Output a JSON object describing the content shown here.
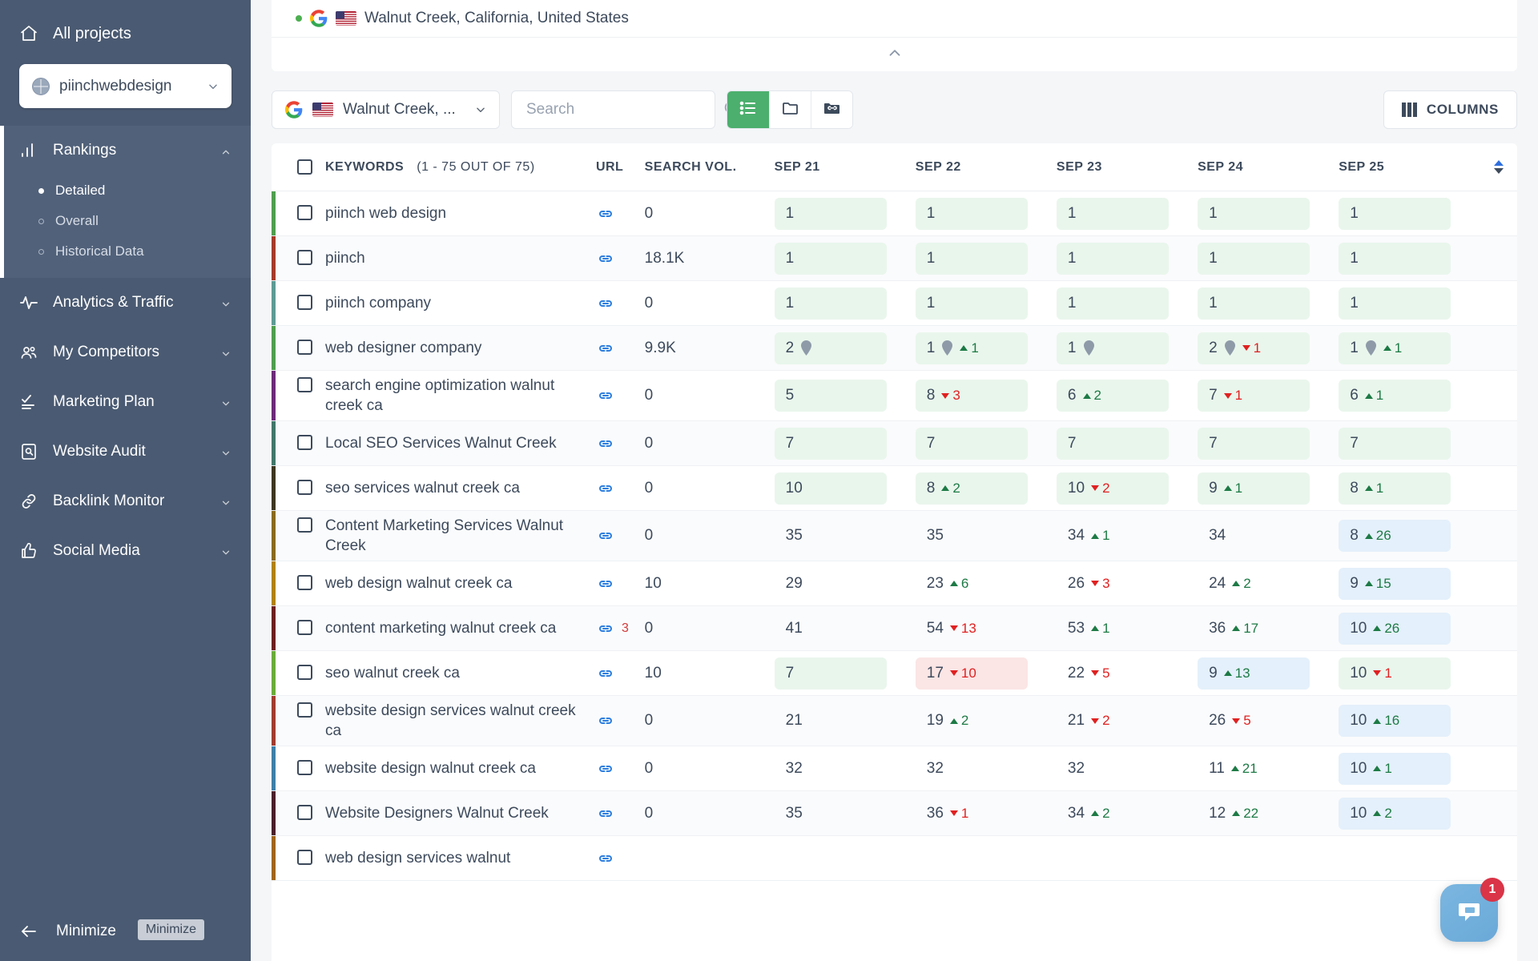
{
  "sidebar": {
    "all_projects_label": "All projects",
    "project_name": "piinchwebdesign",
    "minimize_label": "Minimize",
    "minimize_tooltip": "Minimize",
    "groups": [
      {
        "label": "Rankings",
        "icon": "bar-chart-icon",
        "expanded": true,
        "items": [
          {
            "label": "Detailed",
            "selected": true
          },
          {
            "label": "Overall",
            "selected": false
          },
          {
            "label": "Historical Data",
            "selected": false
          }
        ]
      },
      {
        "label": "Analytics & Traffic",
        "icon": "activity-icon",
        "expanded": false,
        "items": []
      },
      {
        "label": "My Competitors",
        "icon": "people-icon",
        "expanded": false,
        "items": []
      },
      {
        "label": "Marketing Plan",
        "icon": "checklist-icon",
        "expanded": false,
        "items": []
      },
      {
        "label": "Website Audit",
        "icon": "audit-icon",
        "expanded": false,
        "items": []
      },
      {
        "label": "Backlink Monitor",
        "icon": "link-icon",
        "expanded": false,
        "items": []
      },
      {
        "label": "Social Media",
        "icon": "thumbs-up-icon",
        "expanded": false,
        "items": []
      }
    ]
  },
  "header": {
    "location_full": "Walnut Creek, California, United States",
    "engine_icon": "google-icon",
    "flag_icon": "us-flag-icon",
    "status_dot_color": "#4caf50"
  },
  "toolbar": {
    "location_short": "Walnut Creek, ...",
    "search_placeholder": "Search",
    "search_value": "",
    "columns_label": "COLUMNS",
    "views": [
      {
        "name": "list-view",
        "icon": "list-icon",
        "active": true
      },
      {
        "name": "folder-view",
        "icon": "folder-icon",
        "active": false
      },
      {
        "name": "linked-folder-view",
        "icon": "folder-link-icon",
        "active": false
      }
    ]
  },
  "table": {
    "headers": {
      "keywords": "KEYWORDS",
      "keywords_count": "(1 - 75 OUT OF 75)",
      "url": "URL",
      "search_vol": "SEARCH VOL.",
      "days": [
        "SEP 21",
        "SEP 22",
        "SEP 23",
        "SEP 24",
        "SEP 25"
      ]
    },
    "rows": [
      {
        "keyword": "piinch web design",
        "bar": "#4f9e4f",
        "vol": "0",
        "url_badge": "",
        "cells": [
          {
            "rank": "1",
            "delta": "",
            "dir": "",
            "bg": "green",
            "pin": false
          },
          {
            "rank": "1",
            "delta": "",
            "dir": "",
            "bg": "green",
            "pin": false
          },
          {
            "rank": "1",
            "delta": "",
            "dir": "",
            "bg": "green",
            "pin": false
          },
          {
            "rank": "1",
            "delta": "",
            "dir": "",
            "bg": "green",
            "pin": false
          },
          {
            "rank": "1",
            "delta": "",
            "dir": "",
            "bg": "green",
            "pin": false
          }
        ]
      },
      {
        "keyword": "piinch",
        "bar": "#a53a2a",
        "vol": "18.1K",
        "url_badge": "",
        "cells": [
          {
            "rank": "1",
            "delta": "",
            "dir": "",
            "bg": "green",
            "pin": false
          },
          {
            "rank": "1",
            "delta": "",
            "dir": "",
            "bg": "green",
            "pin": false
          },
          {
            "rank": "1",
            "delta": "",
            "dir": "",
            "bg": "green",
            "pin": false
          },
          {
            "rank": "1",
            "delta": "",
            "dir": "",
            "bg": "green",
            "pin": false
          },
          {
            "rank": "1",
            "delta": "",
            "dir": "",
            "bg": "green",
            "pin": false
          }
        ]
      },
      {
        "keyword": "piinch company",
        "bar": "#5e9a95",
        "vol": "0",
        "url_badge": "",
        "cells": [
          {
            "rank": "1",
            "delta": "",
            "dir": "",
            "bg": "green",
            "pin": false
          },
          {
            "rank": "1",
            "delta": "",
            "dir": "",
            "bg": "green",
            "pin": false
          },
          {
            "rank": "1",
            "delta": "",
            "dir": "",
            "bg": "green",
            "pin": false
          },
          {
            "rank": "1",
            "delta": "",
            "dir": "",
            "bg": "green",
            "pin": false
          },
          {
            "rank": "1",
            "delta": "",
            "dir": "",
            "bg": "green",
            "pin": false
          }
        ]
      },
      {
        "keyword": "web designer company",
        "bar": "#4f9e4f",
        "vol": "9.9K",
        "url_badge": "",
        "cells": [
          {
            "rank": "2",
            "delta": "",
            "dir": "",
            "bg": "green",
            "pin": true
          },
          {
            "rank": "1",
            "delta": "1",
            "dir": "up",
            "bg": "green",
            "pin": true
          },
          {
            "rank": "1",
            "delta": "",
            "dir": "",
            "bg": "green",
            "pin": true
          },
          {
            "rank": "2",
            "delta": "1",
            "dir": "down",
            "bg": "green",
            "pin": true
          },
          {
            "rank": "1",
            "delta": "1",
            "dir": "up",
            "bg": "green",
            "pin": true
          }
        ]
      },
      {
        "keyword": "search engine optimization walnut creek ca",
        "bar": "#6b2a78",
        "vol": "0",
        "url_badge": "",
        "cells": [
          {
            "rank": "5",
            "delta": "",
            "dir": "",
            "bg": "green",
            "pin": false
          },
          {
            "rank": "8",
            "delta": "3",
            "dir": "down",
            "bg": "green",
            "pin": false
          },
          {
            "rank": "6",
            "delta": "2",
            "dir": "up",
            "bg": "green",
            "pin": false
          },
          {
            "rank": "7",
            "delta": "1",
            "dir": "down",
            "bg": "green",
            "pin": false
          },
          {
            "rank": "6",
            "delta": "1",
            "dir": "up",
            "bg": "green",
            "pin": false
          }
        ]
      },
      {
        "keyword": "Local SEO Services Walnut Creek",
        "bar": "#41776b",
        "vol": "0",
        "url_badge": "",
        "cells": [
          {
            "rank": "7",
            "delta": "",
            "dir": "",
            "bg": "green",
            "pin": false
          },
          {
            "rank": "7",
            "delta": "",
            "dir": "",
            "bg": "green",
            "pin": false
          },
          {
            "rank": "7",
            "delta": "",
            "dir": "",
            "bg": "green",
            "pin": false
          },
          {
            "rank": "7",
            "delta": "",
            "dir": "",
            "bg": "green",
            "pin": false
          },
          {
            "rank": "7",
            "delta": "",
            "dir": "",
            "bg": "green",
            "pin": false
          }
        ]
      },
      {
        "keyword": "seo services walnut creek ca",
        "bar": "#3e3622",
        "vol": "0",
        "url_badge": "",
        "cells": [
          {
            "rank": "10",
            "delta": "",
            "dir": "",
            "bg": "green",
            "pin": false
          },
          {
            "rank": "8",
            "delta": "2",
            "dir": "up",
            "bg": "green",
            "pin": false
          },
          {
            "rank": "10",
            "delta": "2",
            "dir": "down",
            "bg": "green",
            "pin": false
          },
          {
            "rank": "9",
            "delta": "1",
            "dir": "up",
            "bg": "green",
            "pin": false
          },
          {
            "rank": "8",
            "delta": "1",
            "dir": "up",
            "bg": "green",
            "pin": false
          }
        ]
      },
      {
        "keyword": "Content Marketing Services Walnut Creek",
        "bar": "#8a6a1e",
        "vol": "0",
        "url_badge": "",
        "cells": [
          {
            "rank": "35",
            "delta": "",
            "dir": "",
            "bg": "none",
            "pin": false
          },
          {
            "rank": "35",
            "delta": "",
            "dir": "",
            "bg": "none",
            "pin": false
          },
          {
            "rank": "34",
            "delta": "1",
            "dir": "up",
            "bg": "none",
            "pin": false
          },
          {
            "rank": "34",
            "delta": "",
            "dir": "",
            "bg": "none",
            "pin": false
          },
          {
            "rank": "8",
            "delta": "26",
            "dir": "up",
            "bg": "blue",
            "pin": false
          }
        ]
      },
      {
        "keyword": "web design walnut creek ca",
        "bar": "#b2820f",
        "vol": "10",
        "url_badge": "",
        "cells": [
          {
            "rank": "29",
            "delta": "",
            "dir": "",
            "bg": "none",
            "pin": false
          },
          {
            "rank": "23",
            "delta": "6",
            "dir": "up",
            "bg": "none",
            "pin": false
          },
          {
            "rank": "26",
            "delta": "3",
            "dir": "down",
            "bg": "none",
            "pin": false
          },
          {
            "rank": "24",
            "delta": "2",
            "dir": "up",
            "bg": "none",
            "pin": false
          },
          {
            "rank": "9",
            "delta": "15",
            "dir": "up",
            "bg": "blue",
            "pin": false
          }
        ]
      },
      {
        "keyword": "content marketing walnut creek ca",
        "bar": "#6d1f1f",
        "vol": "0",
        "url_badge": "3",
        "cells": [
          {
            "rank": "41",
            "delta": "",
            "dir": "",
            "bg": "none",
            "pin": false
          },
          {
            "rank": "54",
            "delta": "13",
            "dir": "down",
            "bg": "none",
            "pin": false
          },
          {
            "rank": "53",
            "delta": "1",
            "dir": "up",
            "bg": "none",
            "pin": false
          },
          {
            "rank": "36",
            "delta": "17",
            "dir": "up",
            "bg": "none",
            "pin": false
          },
          {
            "rank": "10",
            "delta": "26",
            "dir": "up",
            "bg": "blue",
            "pin": false
          }
        ]
      },
      {
        "keyword": "seo walnut creek ca",
        "bar": "#6aab3a",
        "vol": "10",
        "url_badge": "",
        "cells": [
          {
            "rank": "7",
            "delta": "",
            "dir": "",
            "bg": "green",
            "pin": false
          },
          {
            "rank": "17",
            "delta": "10",
            "dir": "down",
            "bg": "red",
            "pin": false
          },
          {
            "rank": "22",
            "delta": "5",
            "dir": "down",
            "bg": "none",
            "pin": false
          },
          {
            "rank": "9",
            "delta": "13",
            "dir": "up",
            "bg": "blue",
            "pin": false
          },
          {
            "rank": "10",
            "delta": "1",
            "dir": "down",
            "bg": "green",
            "pin": false
          }
        ]
      },
      {
        "keyword": "website design services walnut creek ca",
        "bar": "#a03c30",
        "vol": "0",
        "url_badge": "",
        "cells": [
          {
            "rank": "21",
            "delta": "",
            "dir": "",
            "bg": "none",
            "pin": false
          },
          {
            "rank": "19",
            "delta": "2",
            "dir": "up",
            "bg": "none",
            "pin": false
          },
          {
            "rank": "21",
            "delta": "2",
            "dir": "down",
            "bg": "none",
            "pin": false
          },
          {
            "rank": "26",
            "delta": "5",
            "dir": "down",
            "bg": "none",
            "pin": false
          },
          {
            "rank": "10",
            "delta": "16",
            "dir": "up",
            "bg": "blue",
            "pin": false
          }
        ]
      },
      {
        "keyword": "website design walnut creek ca",
        "bar": "#3f7fa8",
        "vol": "0",
        "url_badge": "",
        "cells": [
          {
            "rank": "32",
            "delta": "",
            "dir": "",
            "bg": "none",
            "pin": false
          },
          {
            "rank": "32",
            "delta": "",
            "dir": "",
            "bg": "none",
            "pin": false
          },
          {
            "rank": "32",
            "delta": "",
            "dir": "",
            "bg": "none",
            "pin": false
          },
          {
            "rank": "11",
            "delta": "21",
            "dir": "up",
            "bg": "none",
            "pin": false
          },
          {
            "rank": "10",
            "delta": "1",
            "dir": "up",
            "bg": "blue",
            "pin": false
          }
        ]
      },
      {
        "keyword": "Website Designers Walnut Creek",
        "bar": "#4a1f2a",
        "vol": "0",
        "url_badge": "",
        "cells": [
          {
            "rank": "35",
            "delta": "",
            "dir": "",
            "bg": "none",
            "pin": false
          },
          {
            "rank": "36",
            "delta": "1",
            "dir": "down",
            "bg": "none",
            "pin": false
          },
          {
            "rank": "34",
            "delta": "2",
            "dir": "up",
            "bg": "none",
            "pin": false
          },
          {
            "rank": "12",
            "delta": "22",
            "dir": "up",
            "bg": "none",
            "pin": false
          },
          {
            "rank": "10",
            "delta": "2",
            "dir": "up",
            "bg": "blue",
            "pin": false
          }
        ]
      },
      {
        "keyword": "web design services walnut",
        "bar": "#a0651c",
        "vol": "",
        "url_badge": "",
        "cells": []
      }
    ]
  },
  "chat": {
    "badge_count": "1",
    "icon": "chat-bubble-icon"
  }
}
